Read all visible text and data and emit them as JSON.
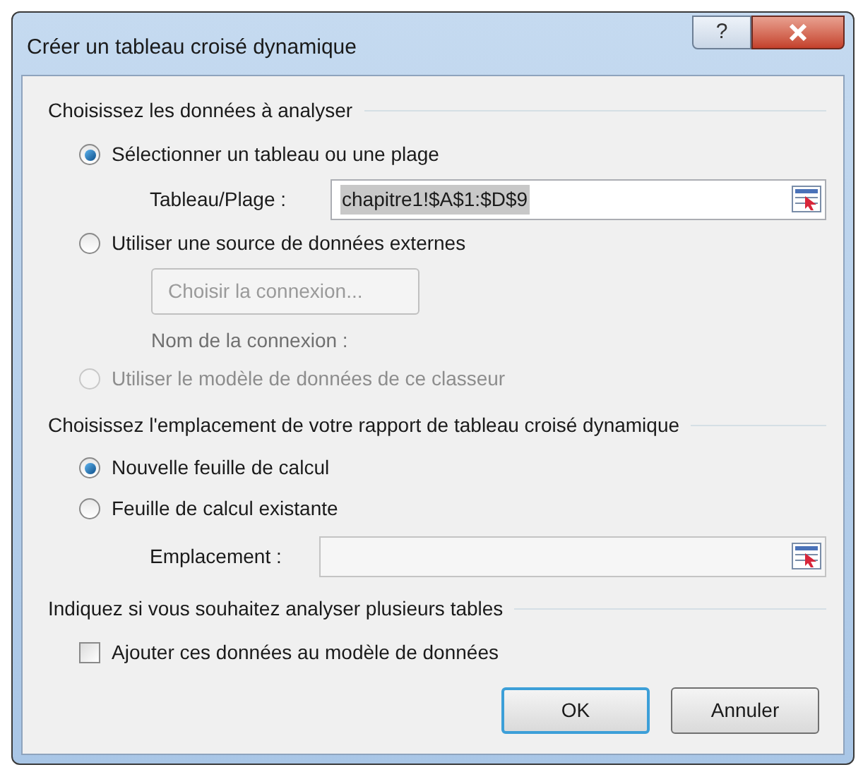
{
  "window": {
    "title": "Créer un tableau croisé dynamique",
    "help": "?"
  },
  "source": {
    "heading": "Choisissez les données à analyser",
    "options": [
      {
        "label": "Sélectionner un tableau ou une plage",
        "selected": true,
        "disabled": false
      },
      {
        "label": "Utiliser une source de données externes",
        "selected": false,
        "disabled": false
      },
      {
        "label": "Utiliser le modèle de données de ce classeur",
        "selected": false,
        "disabled": true
      }
    ],
    "range_field": {
      "label": "Tableau/Plage :",
      "value": "chapitre1!$A$1:$D$9"
    },
    "connection_button": {
      "label": "Choisir la connexion...",
      "disabled": true
    },
    "connection_name": {
      "label": "Nom de la connexion :",
      "disabled": true
    }
  },
  "destination": {
    "heading": "Choisissez l'emplacement de votre rapport de tableau croisé dynamique",
    "options": [
      {
        "label": "Nouvelle feuille de calcul",
        "selected": true,
        "disabled": false
      },
      {
        "label": "Feuille de calcul existante",
        "selected": false,
        "disabled": false
      }
    ],
    "location_field": {
      "label": "Emplacement :"
    }
  },
  "multiple": {
    "heading": "Indiquez si vous souhaitez analyser plusieurs tables",
    "checkbox": {
      "label": "Ajouter ces données au modèle de données",
      "checked": false
    }
  },
  "buttons": [
    {
      "label": "OK",
      "default": true
    },
    {
      "label": "Annuler",
      "default": false
    }
  ]
}
